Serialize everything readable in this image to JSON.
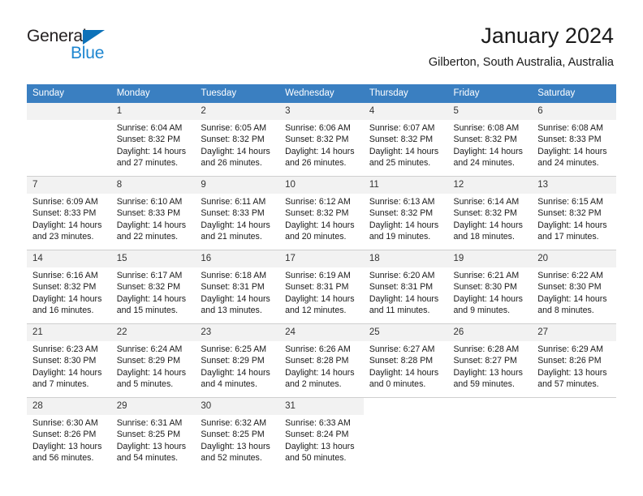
{
  "brand": {
    "name_part1": "General",
    "name_part2": "Blue",
    "accent_color": "#1d86d0",
    "triangle_color": "#0d72b9"
  },
  "header": {
    "title": "January 2024",
    "subtitle": "Gilberton, South Australia, Australia",
    "header_bg": "#3a7fc1"
  },
  "weekdays": [
    "Sunday",
    "Monday",
    "Tuesday",
    "Wednesday",
    "Thursday",
    "Friday",
    "Saturday"
  ],
  "weeks": [
    [
      {
        "day": "",
        "empty": true,
        "sunrise": "",
        "sunset": "",
        "daylight1": "",
        "daylight2": ""
      },
      {
        "day": "1",
        "sunrise": "Sunrise: 6:04 AM",
        "sunset": "Sunset: 8:32 PM",
        "daylight1": "Daylight: 14 hours",
        "daylight2": "and 27 minutes."
      },
      {
        "day": "2",
        "sunrise": "Sunrise: 6:05 AM",
        "sunset": "Sunset: 8:32 PM",
        "daylight1": "Daylight: 14 hours",
        "daylight2": "and 26 minutes."
      },
      {
        "day": "3",
        "sunrise": "Sunrise: 6:06 AM",
        "sunset": "Sunset: 8:32 PM",
        "daylight1": "Daylight: 14 hours",
        "daylight2": "and 26 minutes."
      },
      {
        "day": "4",
        "sunrise": "Sunrise: 6:07 AM",
        "sunset": "Sunset: 8:32 PM",
        "daylight1": "Daylight: 14 hours",
        "daylight2": "and 25 minutes."
      },
      {
        "day": "5",
        "sunrise": "Sunrise: 6:08 AM",
        "sunset": "Sunset: 8:32 PM",
        "daylight1": "Daylight: 14 hours",
        "daylight2": "and 24 minutes."
      },
      {
        "day": "6",
        "sunrise": "Sunrise: 6:08 AM",
        "sunset": "Sunset: 8:33 PM",
        "daylight1": "Daylight: 14 hours",
        "daylight2": "and 24 minutes."
      }
    ],
    [
      {
        "day": "7",
        "sunrise": "Sunrise: 6:09 AM",
        "sunset": "Sunset: 8:33 PM",
        "daylight1": "Daylight: 14 hours",
        "daylight2": "and 23 minutes."
      },
      {
        "day": "8",
        "sunrise": "Sunrise: 6:10 AM",
        "sunset": "Sunset: 8:33 PM",
        "daylight1": "Daylight: 14 hours",
        "daylight2": "and 22 minutes."
      },
      {
        "day": "9",
        "sunrise": "Sunrise: 6:11 AM",
        "sunset": "Sunset: 8:33 PM",
        "daylight1": "Daylight: 14 hours",
        "daylight2": "and 21 minutes."
      },
      {
        "day": "10",
        "sunrise": "Sunrise: 6:12 AM",
        "sunset": "Sunset: 8:32 PM",
        "daylight1": "Daylight: 14 hours",
        "daylight2": "and 20 minutes."
      },
      {
        "day": "11",
        "sunrise": "Sunrise: 6:13 AM",
        "sunset": "Sunset: 8:32 PM",
        "daylight1": "Daylight: 14 hours",
        "daylight2": "and 19 minutes."
      },
      {
        "day": "12",
        "sunrise": "Sunrise: 6:14 AM",
        "sunset": "Sunset: 8:32 PM",
        "daylight1": "Daylight: 14 hours",
        "daylight2": "and 18 minutes."
      },
      {
        "day": "13",
        "sunrise": "Sunrise: 6:15 AM",
        "sunset": "Sunset: 8:32 PM",
        "daylight1": "Daylight: 14 hours",
        "daylight2": "and 17 minutes."
      }
    ],
    [
      {
        "day": "14",
        "sunrise": "Sunrise: 6:16 AM",
        "sunset": "Sunset: 8:32 PM",
        "daylight1": "Daylight: 14 hours",
        "daylight2": "and 16 minutes."
      },
      {
        "day": "15",
        "sunrise": "Sunrise: 6:17 AM",
        "sunset": "Sunset: 8:32 PM",
        "daylight1": "Daylight: 14 hours",
        "daylight2": "and 15 minutes."
      },
      {
        "day": "16",
        "sunrise": "Sunrise: 6:18 AM",
        "sunset": "Sunset: 8:31 PM",
        "daylight1": "Daylight: 14 hours",
        "daylight2": "and 13 minutes."
      },
      {
        "day": "17",
        "sunrise": "Sunrise: 6:19 AM",
        "sunset": "Sunset: 8:31 PM",
        "daylight1": "Daylight: 14 hours",
        "daylight2": "and 12 minutes."
      },
      {
        "day": "18",
        "sunrise": "Sunrise: 6:20 AM",
        "sunset": "Sunset: 8:31 PM",
        "daylight1": "Daylight: 14 hours",
        "daylight2": "and 11 minutes."
      },
      {
        "day": "19",
        "sunrise": "Sunrise: 6:21 AM",
        "sunset": "Sunset: 8:30 PM",
        "daylight1": "Daylight: 14 hours",
        "daylight2": "and 9 minutes."
      },
      {
        "day": "20",
        "sunrise": "Sunrise: 6:22 AM",
        "sunset": "Sunset: 8:30 PM",
        "daylight1": "Daylight: 14 hours",
        "daylight2": "and 8 minutes."
      }
    ],
    [
      {
        "day": "21",
        "sunrise": "Sunrise: 6:23 AM",
        "sunset": "Sunset: 8:30 PM",
        "daylight1": "Daylight: 14 hours",
        "daylight2": "and 7 minutes."
      },
      {
        "day": "22",
        "sunrise": "Sunrise: 6:24 AM",
        "sunset": "Sunset: 8:29 PM",
        "daylight1": "Daylight: 14 hours",
        "daylight2": "and 5 minutes."
      },
      {
        "day": "23",
        "sunrise": "Sunrise: 6:25 AM",
        "sunset": "Sunset: 8:29 PM",
        "daylight1": "Daylight: 14 hours",
        "daylight2": "and 4 minutes."
      },
      {
        "day": "24",
        "sunrise": "Sunrise: 6:26 AM",
        "sunset": "Sunset: 8:28 PM",
        "daylight1": "Daylight: 14 hours",
        "daylight2": "and 2 minutes."
      },
      {
        "day": "25",
        "sunrise": "Sunrise: 6:27 AM",
        "sunset": "Sunset: 8:28 PM",
        "daylight1": "Daylight: 14 hours",
        "daylight2": "and 0 minutes."
      },
      {
        "day": "26",
        "sunrise": "Sunrise: 6:28 AM",
        "sunset": "Sunset: 8:27 PM",
        "daylight1": "Daylight: 13 hours",
        "daylight2": "and 59 minutes."
      },
      {
        "day": "27",
        "sunrise": "Sunrise: 6:29 AM",
        "sunset": "Sunset: 8:26 PM",
        "daylight1": "Daylight: 13 hours",
        "daylight2": "and 57 minutes."
      }
    ],
    [
      {
        "day": "28",
        "sunrise": "Sunrise: 6:30 AM",
        "sunset": "Sunset: 8:26 PM",
        "daylight1": "Daylight: 13 hours",
        "daylight2": "and 56 minutes."
      },
      {
        "day": "29",
        "sunrise": "Sunrise: 6:31 AM",
        "sunset": "Sunset: 8:25 PM",
        "daylight1": "Daylight: 13 hours",
        "daylight2": "and 54 minutes."
      },
      {
        "day": "30",
        "sunrise": "Sunrise: 6:32 AM",
        "sunset": "Sunset: 8:25 PM",
        "daylight1": "Daylight: 13 hours",
        "daylight2": "and 52 minutes."
      },
      {
        "day": "31",
        "sunrise": "Sunrise: 6:33 AM",
        "sunset": "Sunset: 8:24 PM",
        "daylight1": "Daylight: 13 hours",
        "daylight2": "and 50 minutes."
      },
      {
        "day": "",
        "blank": true,
        "sunrise": "",
        "sunset": "",
        "daylight1": "",
        "daylight2": ""
      },
      {
        "day": "",
        "blank": true,
        "sunrise": "",
        "sunset": "",
        "daylight1": "",
        "daylight2": ""
      },
      {
        "day": "",
        "blank": true,
        "sunrise": "",
        "sunset": "",
        "daylight1": "",
        "daylight2": ""
      }
    ]
  ]
}
